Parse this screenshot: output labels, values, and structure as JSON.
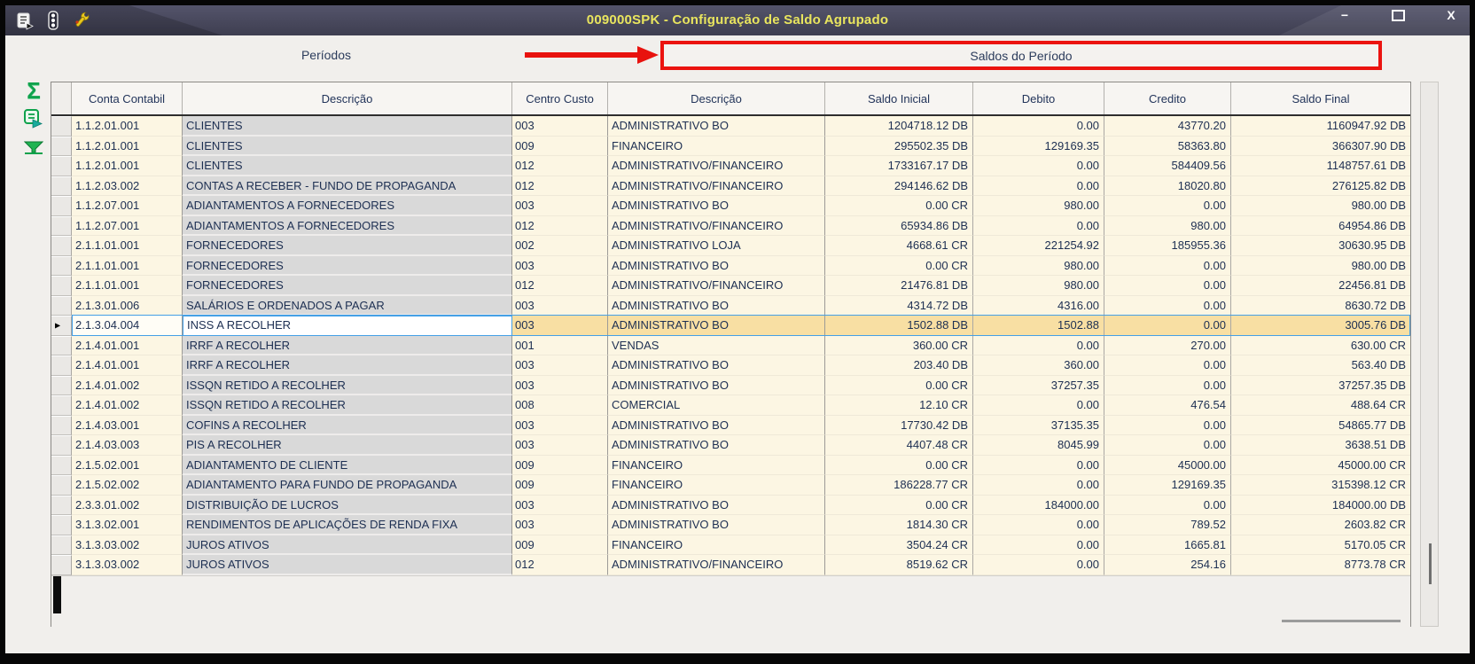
{
  "window": {
    "title": "009000SPK - Configuração de Saldo Agrupado",
    "controls": {
      "minimize": "−",
      "close": "X"
    },
    "toolbar_icons": [
      "form-icon",
      "traffic-light-icon",
      "wrench-icon"
    ]
  },
  "panels": {
    "left_header": "Períodos",
    "right_header": "Saldos do Período"
  },
  "annotation": {
    "arrow_color": "#e8120e",
    "box_color": "#eb130f"
  },
  "sidebar": {
    "icons": [
      {
        "name": "sum-icon",
        "glyph": "Σ"
      },
      {
        "name": "export-icon"
      },
      {
        "name": "filter-icon"
      }
    ]
  },
  "colors": {
    "titlebar": "#47475a",
    "title_text": "#e9e55e",
    "selection_border": "#45a0e6",
    "selection_fill": "#f8dfa3",
    "cell_cream": "#fcf6e3",
    "cell_gray": "#d9d9d9",
    "icon_green": "#0fa24c"
  },
  "table": {
    "columns": [
      "Conta Contabil",
      "Descrição",
      "Centro Custo",
      "Descrição",
      "Saldo Inicial",
      "Debito",
      "Credito",
      "Saldo Final"
    ],
    "selected_row_index": 10,
    "selected_marker": "▶",
    "rows": [
      {
        "conta": "1.1.2.01.001",
        "descricao": "CLIENTES",
        "centro": "003",
        "centro_descricao": "ADMINISTRATIVO BO",
        "saldo_inicial": "1204718.12 DB",
        "debito": "0.00",
        "credito": "43770.20",
        "saldo_final": "1160947.92 DB"
      },
      {
        "conta": "1.1.2.01.001",
        "descricao": "CLIENTES",
        "centro": "009",
        "centro_descricao": "FINANCEIRO",
        "saldo_inicial": "295502.35 DB",
        "debito": "129169.35",
        "credito": "58363.80",
        "saldo_final": "366307.90 DB"
      },
      {
        "conta": "1.1.2.01.001",
        "descricao": "CLIENTES",
        "centro": "012",
        "centro_descricao": "ADMINISTRATIVO/FINANCEIRO",
        "saldo_inicial": "1733167.17 DB",
        "debito": "0.00",
        "credito": "584409.56",
        "saldo_final": "1148757.61 DB"
      },
      {
        "conta": "1.1.2.03.002",
        "descricao": "CONTAS A RECEBER - FUNDO DE PROPAGANDA",
        "centro": "012",
        "centro_descricao": "ADMINISTRATIVO/FINANCEIRO",
        "saldo_inicial": "294146.62 DB",
        "debito": "0.00",
        "credito": "18020.80",
        "saldo_final": "276125.82 DB"
      },
      {
        "conta": "1.1.2.07.001",
        "descricao": "ADIANTAMENTOS A FORNECEDORES",
        "centro": "003",
        "centro_descricao": "ADMINISTRATIVO BO",
        "saldo_inicial": "0.00 CR",
        "debito": "980.00",
        "credito": "0.00",
        "saldo_final": "980.00 DB"
      },
      {
        "conta": "1.1.2.07.001",
        "descricao": "ADIANTAMENTOS A FORNECEDORES",
        "centro": "012",
        "centro_descricao": "ADMINISTRATIVO/FINANCEIRO",
        "saldo_inicial": "65934.86 DB",
        "debito": "0.00",
        "credito": "980.00",
        "saldo_final": "64954.86 DB"
      },
      {
        "conta": "2.1.1.01.001",
        "descricao": "FORNECEDORES",
        "centro": "002",
        "centro_descricao": "ADMINISTRATIVO LOJA",
        "saldo_inicial": "4668.61 CR",
        "debito": "221254.92",
        "credito": "185955.36",
        "saldo_final": "30630.95 DB"
      },
      {
        "conta": "2.1.1.01.001",
        "descricao": "FORNECEDORES",
        "centro": "003",
        "centro_descricao": "ADMINISTRATIVO BO",
        "saldo_inicial": "0.00 CR",
        "debito": "980.00",
        "credito": "0.00",
        "saldo_final": "980.00 DB"
      },
      {
        "conta": "2.1.1.01.001",
        "descricao": "FORNECEDORES",
        "centro": "012",
        "centro_descricao": "ADMINISTRATIVO/FINANCEIRO",
        "saldo_inicial": "21476.81 DB",
        "debito": "980.00",
        "credito": "0.00",
        "saldo_final": "22456.81 DB"
      },
      {
        "conta": "2.1.3.01.006",
        "descricao": "SALÁRIOS E ORDENADOS A PAGAR",
        "centro": "003",
        "centro_descricao": "ADMINISTRATIVO BO",
        "saldo_inicial": "4314.72 DB",
        "debito": "4316.00",
        "credito": "0.00",
        "saldo_final": "8630.72 DB"
      },
      {
        "conta": "2.1.3.04.004",
        "descricao": "INSS A RECOLHER",
        "centro": "003",
        "centro_descricao": "ADMINISTRATIVO BO",
        "saldo_inicial": "1502.88 DB",
        "debito": "1502.88",
        "credito": "0.00",
        "saldo_final": "3005.76 DB"
      },
      {
        "conta": "2.1.4.01.001",
        "descricao": "IRRF A RECOLHER",
        "centro": "001",
        "centro_descricao": "VENDAS",
        "saldo_inicial": "360.00 CR",
        "debito": "0.00",
        "credito": "270.00",
        "saldo_final": "630.00 CR"
      },
      {
        "conta": "2.1.4.01.001",
        "descricao": "IRRF A RECOLHER",
        "centro": "003",
        "centro_descricao": "ADMINISTRATIVO BO",
        "saldo_inicial": "203.40 DB",
        "debito": "360.00",
        "credito": "0.00",
        "saldo_final": "563.40 DB"
      },
      {
        "conta": "2.1.4.01.002",
        "descricao": "ISSQN RETIDO A RECOLHER",
        "centro": "003",
        "centro_descricao": "ADMINISTRATIVO BO",
        "saldo_inicial": "0.00 CR",
        "debito": "37257.35",
        "credito": "0.00",
        "saldo_final": "37257.35 DB"
      },
      {
        "conta": "2.1.4.01.002",
        "descricao": "ISSQN RETIDO A RECOLHER",
        "centro": "008",
        "centro_descricao": "COMERCIAL",
        "saldo_inicial": "12.10 CR",
        "debito": "0.00",
        "credito": "476.54",
        "saldo_final": "488.64 CR"
      },
      {
        "conta": "2.1.4.03.001",
        "descricao": "COFINS A RECOLHER",
        "centro": "003",
        "centro_descricao": "ADMINISTRATIVO BO",
        "saldo_inicial": "17730.42 DB",
        "debito": "37135.35",
        "credito": "0.00",
        "saldo_final": "54865.77 DB"
      },
      {
        "conta": "2.1.4.03.003",
        "descricao": "PIS A RECOLHER",
        "centro": "003",
        "centro_descricao": "ADMINISTRATIVO BO",
        "saldo_inicial": "4407.48 CR",
        "debito": "8045.99",
        "credito": "0.00",
        "saldo_final": "3638.51 DB"
      },
      {
        "conta": "2.1.5.02.001",
        "descricao": "ADIANTAMENTO DE CLIENTE",
        "centro": "009",
        "centro_descricao": "FINANCEIRO",
        "saldo_inicial": "0.00 CR",
        "debito": "0.00",
        "credito": "45000.00",
        "saldo_final": "45000.00 CR"
      },
      {
        "conta": "2.1.5.02.002",
        "descricao": "ADIANTAMENTO PARA FUNDO DE PROPAGANDA",
        "centro": "009",
        "centro_descricao": "FINANCEIRO",
        "saldo_inicial": "186228.77 CR",
        "debito": "0.00",
        "credito": "129169.35",
        "saldo_final": "315398.12 CR"
      },
      {
        "conta": "2.3.3.01.002",
        "descricao": "DISTRIBUIÇÃO DE LUCROS",
        "centro": "003",
        "centro_descricao": "ADMINISTRATIVO BO",
        "saldo_inicial": "0.00 CR",
        "debito": "184000.00",
        "credito": "0.00",
        "saldo_final": "184000.00 DB"
      },
      {
        "conta": "3.1.3.02.001",
        "descricao": "RENDIMENTOS DE APLICAÇÕES DE RENDA FIXA",
        "centro": "003",
        "centro_descricao": "ADMINISTRATIVO BO",
        "saldo_inicial": "1814.30 CR",
        "debito": "0.00",
        "credito": "789.52",
        "saldo_final": "2603.82 CR"
      },
      {
        "conta": "3.1.3.03.002",
        "descricao": "JUROS ATIVOS",
        "centro": "009",
        "centro_descricao": "FINANCEIRO",
        "saldo_inicial": "3504.24 CR",
        "debito": "0.00",
        "credito": "1665.81",
        "saldo_final": "5170.05 CR"
      },
      {
        "conta": "3.1.3.03.002",
        "descricao": "JUROS ATIVOS",
        "centro": "012",
        "centro_descricao": "ADMINISTRATIVO/FINANCEIRO",
        "saldo_inicial": "8519.62 CR",
        "debito": "0.00",
        "credito": "254.16",
        "saldo_final": "8773.78 CR"
      }
    ]
  }
}
